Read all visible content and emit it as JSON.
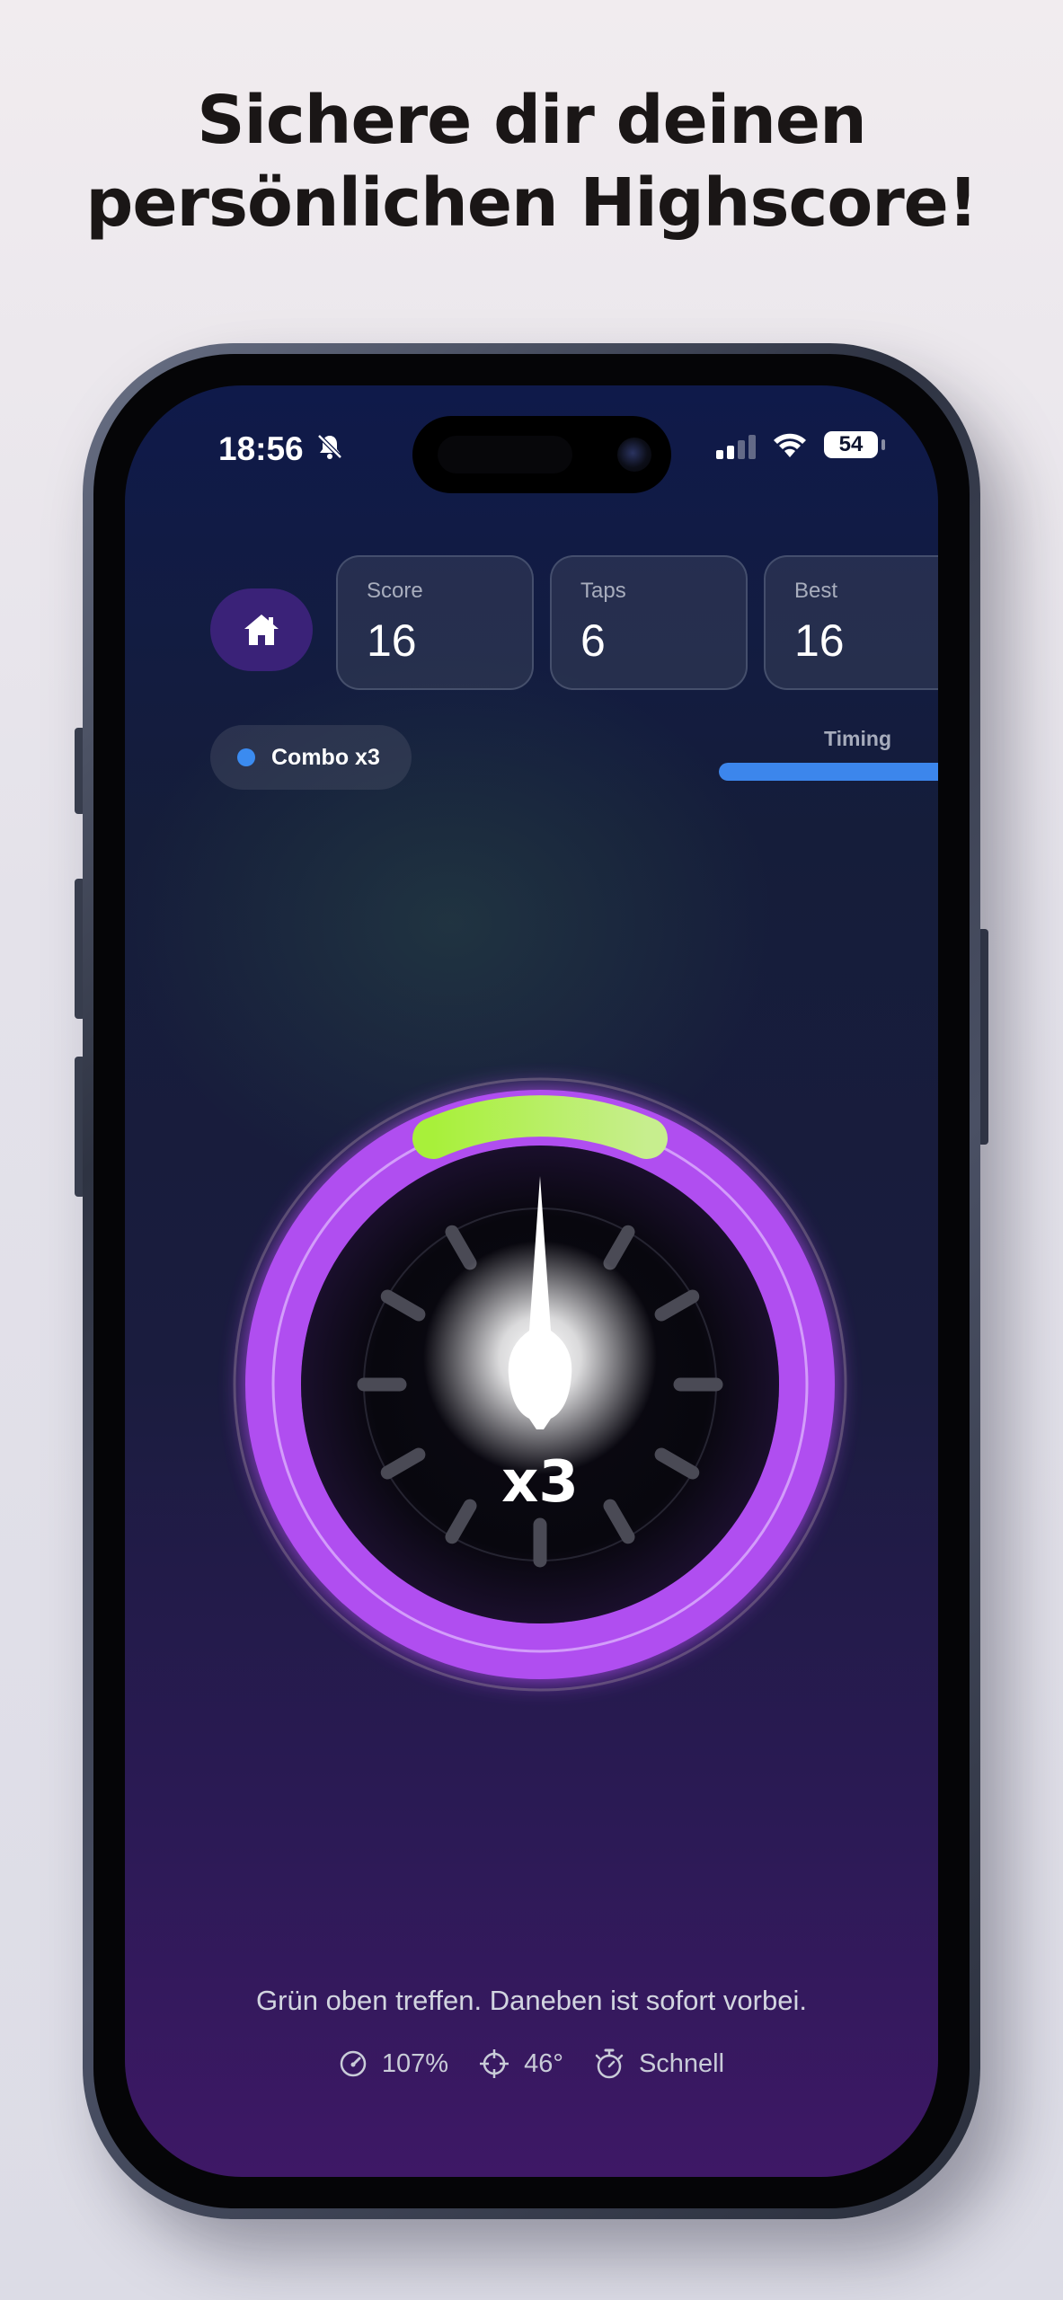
{
  "headline": {
    "line1": "Sichere dir deinen",
    "line2": "persönlichen Highscore!"
  },
  "status_bar": {
    "time": "18:56",
    "battery": "54",
    "icons": [
      "bell-off-icon",
      "signal-icon",
      "wifi-icon",
      "battery-icon"
    ]
  },
  "hud": {
    "home_icon": "home-icon",
    "stats": [
      {
        "label": "Score",
        "value": "16"
      },
      {
        "label": "Taps",
        "value": "6"
      },
      {
        "label": "Best",
        "value": "16"
      }
    ],
    "combo_label": "Combo x3",
    "timing_label": "Timing",
    "timing_fill": 0.97,
    "colors": {
      "accent_blue": "#3c86ec",
      "home_bg": "#3a2278"
    }
  },
  "dial": {
    "multiplier": "x3",
    "ring_color": "#b04ef0",
    "target_zone_color": "#b8f050"
  },
  "footer": {
    "hint": "Grün oben treffen. Daneben ist sofort vorbei.",
    "speed": "107%",
    "angle": "46°",
    "mode": "Schnell",
    "icons": [
      "speedometer-icon",
      "crosshair-icon",
      "stopwatch-icon"
    ]
  }
}
